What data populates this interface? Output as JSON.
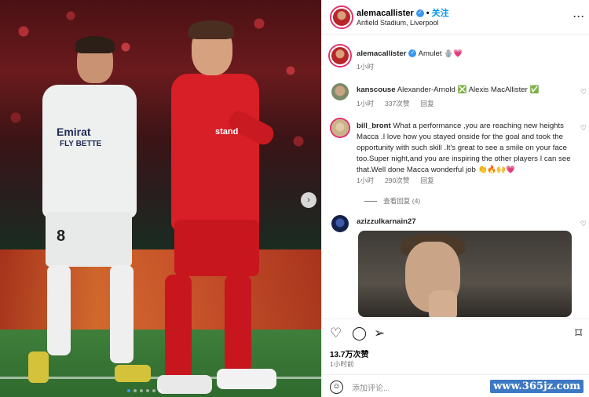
{
  "post": {
    "username": "alemacallister",
    "verified_mark": "✓",
    "follow_label": "关注",
    "separator": "•",
    "location": "Anfield Stadium, Liverpool",
    "more": "···"
  },
  "photo": {
    "shirt_text_white": "Emirat",
    "shirt_text_white2": "FLY BETTE",
    "shirt_number": "8",
    "shirt_text_red": "stand",
    "carousel_next": "›",
    "carousel_count": 6,
    "carousel_active": 0
  },
  "caption": {
    "username": "alemacallister",
    "text": "Amulet 🪬💗",
    "time": "1小时"
  },
  "comments": [
    {
      "username": "kanscouse",
      "text": "Alexander-Arnold ❎ Alexis MacAllister ✅",
      "time": "1小时",
      "likes": "337次赞",
      "reply": "回复"
    },
    {
      "username": "bill_bront",
      "text": "What a performance ,you are reaching new heights Macca .I love how you stayed onside for the goal and took the opportunity with such skill .It's great to see a smile on your face too.Super night,and you are inspiring the other players I can see that.Well done Macca wonderful job 👏🔥🙌💗",
      "time": "1小时",
      "likes": "290次赞",
      "reply": "回复",
      "view_replies": "查看回复 (4)"
    },
    {
      "username": "azizzulkarnain27",
      "text": ""
    }
  ],
  "actions": {
    "like_icon": "♡",
    "comment_icon": "◯",
    "share_icon": "➢",
    "save_icon": "⌑",
    "likes": "13.7万次赞",
    "time": "1小时前",
    "emoji": "☺",
    "add_comment": "添加评论..."
  },
  "watermark": "www.365jz.com",
  "colors": {
    "link_blue": "#0095f6",
    "verified_blue": "#3897f0",
    "liverpool_red": "#d81e26"
  }
}
